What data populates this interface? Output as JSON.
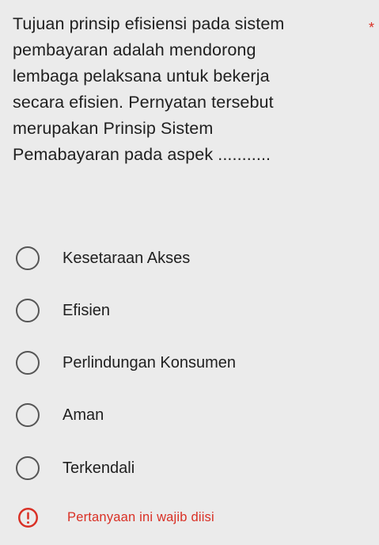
{
  "question": {
    "lines": [
      "Tujuan prinsip efisiensi pada sistem",
      "pembayaran adalah mendorong",
      "lembaga pelaksana untuk bekerja",
      "secara efisien. Pernyatan tersebut",
      "merupakan Prinsip Sistem",
      "Pemabayaran pada aspek ..........."
    ],
    "required_marker": "*"
  },
  "options": [
    {
      "label": "Kesetaraan Akses",
      "selected": false
    },
    {
      "label": "Efisien",
      "selected": false
    },
    {
      "label": "Perlindungan Konsumen",
      "selected": false
    },
    {
      "label": "Aman",
      "selected": false
    },
    {
      "label": "Terkendali",
      "selected": false
    }
  ],
  "validation": {
    "icon": "error-icon",
    "message": "Pertanyaan ini wajib diisi",
    "color": "#d93025"
  }
}
